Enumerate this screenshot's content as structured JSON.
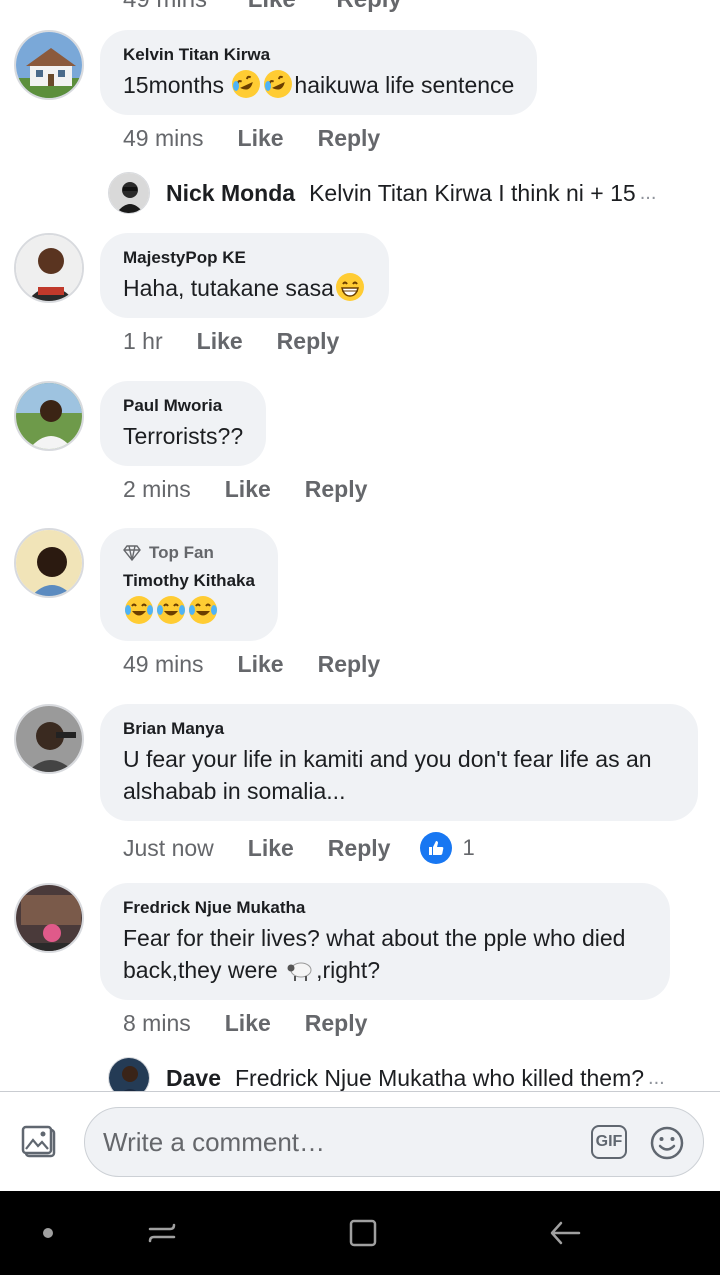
{
  "top_partial": {
    "time": "49 mins",
    "like": "Like",
    "reply": "Reply"
  },
  "comments": [
    {
      "author": "Kelvin Titan Kirwa",
      "text_before": "15months ",
      "emojis": [
        "rolling-laughing",
        "rolling-laughing"
      ],
      "text_after": "haikuwa life sentence",
      "time": "49 mins",
      "like": "Like",
      "reply": "Reply",
      "reply_preview": {
        "name": "Nick Monda",
        "text": "Kelvin Titan Kirwa I think ni + 15",
        "ellipsis": "..."
      }
    },
    {
      "author": "MajestyPop KE",
      "text_before": "Haha, tutakane sasa",
      "emojis": [
        "grin"
      ],
      "text_after": "",
      "time": "1 hr",
      "like": "Like",
      "reply": "Reply"
    },
    {
      "author": "Paul Mworia",
      "text_before": "Terrorists??",
      "emojis": [],
      "text_after": "",
      "time": "2 mins",
      "like": "Like",
      "reply": "Reply"
    },
    {
      "badge": "Top Fan",
      "author": "Timothy Kithaka",
      "text_before": "",
      "emojis": [
        "tears-of-joy",
        "tears-of-joy",
        "tears-of-joy"
      ],
      "text_after": "",
      "time": "49 mins",
      "like": "Like",
      "reply": "Reply"
    },
    {
      "author": "Brian Manya",
      "text_before": "U fear your life in kamiti and you don't fear life as an alshabab in somalia...",
      "emojis": [],
      "text_after": "",
      "time": "Just now",
      "like": "Like",
      "reply": "Reply",
      "reaction_count": "1"
    },
    {
      "author": "Fredrick Njue Mukatha",
      "text_before": "Fear for their lives? what about the pple who died back,they were ",
      "emojis": [
        "sheep"
      ],
      "text_after": ",right?",
      "time": "8 mins",
      "like": "Like",
      "reply": "Reply",
      "reply_preview": {
        "name": "Dave",
        "text": "Fredrick Njue Mukatha who killed them?",
        "ellipsis": "..."
      }
    }
  ],
  "composer": {
    "placeholder": "Write a comment…",
    "gif_label": "GIF",
    "photo_icon": "photo-icon",
    "emoji_icon": "smiley-icon"
  },
  "navbar": {
    "items": [
      "dot-icon",
      "recent-apps-icon",
      "home-icon",
      "back-icon"
    ]
  },
  "colors": {
    "bubble": "#f0f2f5",
    "secondary_text": "#65676b",
    "like_blue": "#1877f2",
    "emoji_yellow": "#ffcc33"
  }
}
